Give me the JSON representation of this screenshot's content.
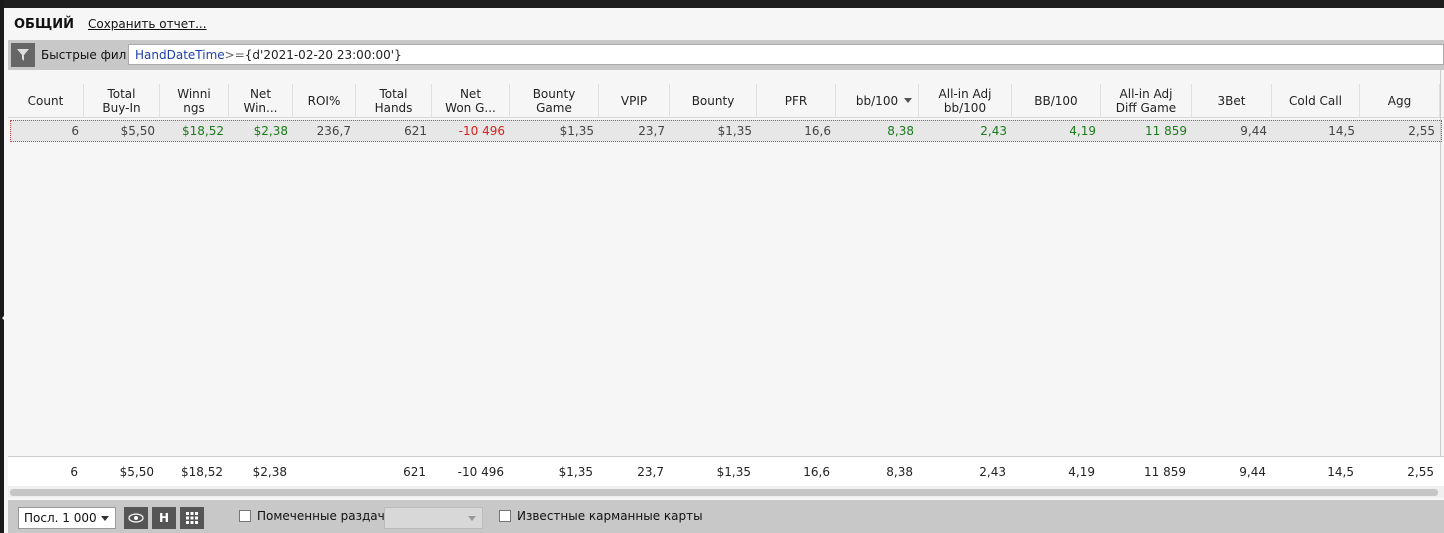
{
  "header": {
    "title": "ОБЩИЙ",
    "save_report": "Сохранить отчет..."
  },
  "filter": {
    "label": "Быстрые фильт",
    "expression_field": "HandDateTime",
    "expression_operator": ">=",
    "expression_value": "{d'2021-02-20 23:00:00'}"
  },
  "columns": [
    "Count",
    "Total\nBuy-In",
    "Winni\nngs",
    "Net\nWin...",
    "ROI%",
    "Total\nHands",
    "Net\nWon G...",
    "Bounty\nGame",
    "VPIP",
    "Bounty",
    "PFR",
    "bb/100",
    "All-in Adj\nbb/100",
    "BB/100",
    "All-in Adj\nDiff Game",
    "3Bet",
    "Cold Call",
    "Agg"
  ],
  "row": [
    "6",
    "$5,50",
    "$18,52",
    "$2,38",
    "236,7",
    "621",
    "-10 496",
    "$1,35",
    "23,7",
    "$1,35",
    "16,6",
    "8,38",
    "2,43",
    "4,19",
    "11 859",
    "9,44",
    "14,5",
    "2,55"
  ],
  "row_colors": [
    "",
    "",
    "pos",
    "pos",
    "",
    "",
    "neg",
    "",
    "",
    "",
    "",
    "pos",
    "pos",
    "pos",
    "pos",
    "",
    "",
    ""
  ],
  "totals": [
    "6",
    "$5,50",
    "$18,52",
    "$2,38",
    "",
    "621",
    "-10 496",
    "$1,35",
    "23,7",
    "$1,35",
    "16,6",
    "8,38",
    "2,43",
    "4,19",
    "11 859",
    "9,44",
    "14,5",
    "2,55"
  ],
  "bottom": {
    "last_select": "Посл. 1 000",
    "h_button": "H",
    "marked_hands": "Помеченные раздачи",
    "known_hole_cards": "Известные карманные карты"
  },
  "icons": {
    "filter": "filter-icon",
    "eye": "eye-icon",
    "grid": "grid-icon"
  }
}
